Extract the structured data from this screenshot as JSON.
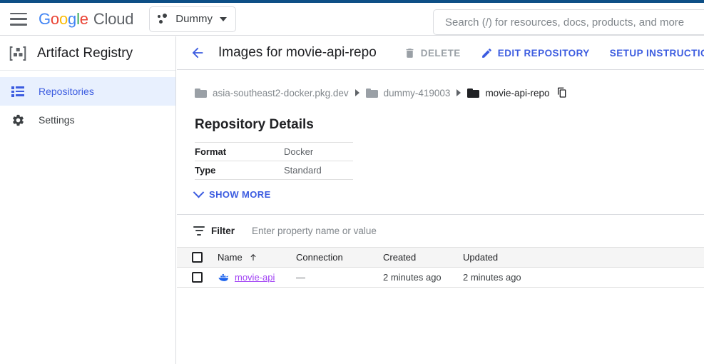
{
  "theme": {
    "accent_blue": "#3c5ce0",
    "top_stripe": "#0d4f86",
    "selected_nav_bg": "#e8f0fe",
    "visited_link_purple": "#a142f4",
    "table_header_bg": "#f5f5f5",
    "muted_text": "#5f6368"
  },
  "header": {
    "menu_icon": "hamburger-menu-icon",
    "logo": {
      "word": "Google",
      "letters": [
        "G",
        "o",
        "o",
        "g",
        "l",
        "e"
      ],
      "suffix": "Cloud"
    },
    "project_picker": {
      "icon": "project-dots-icon",
      "label": "Dummy",
      "caret": "chevron-down-icon"
    },
    "search": {
      "value": "",
      "placeholder": "Search (/) for resources, docs, products, and more",
      "icon": "search-icon"
    }
  },
  "sidebar": {
    "product_icon": "artifact-registry-icon",
    "product_title": "Artifact Registry",
    "items": [
      {
        "label": "Repositories",
        "icon": "list-icon",
        "active": true
      },
      {
        "label": "Settings",
        "icon": "gear-icon",
        "active": false
      }
    ]
  },
  "page": {
    "back_icon": "back-arrow-icon",
    "title": "Images for movie-api-repo",
    "actions": [
      {
        "label": "DELETE",
        "icon": "trash-icon",
        "state": "disabled"
      },
      {
        "label": "EDIT REPOSITORY",
        "icon": "pencil-icon",
        "state": "enabled"
      },
      {
        "label": "SETUP INSTRUCTIONS",
        "icon": "none",
        "state": "enabled"
      }
    ]
  },
  "breadcrumb": {
    "items": [
      {
        "label": "asia-southeast2-docker.pkg.dev",
        "current": false
      },
      {
        "label": "dummy-419003",
        "current": false
      },
      {
        "label": "movie-api-repo",
        "current": true
      }
    ],
    "copy_icon": "copy-icon"
  },
  "details": {
    "heading": "Repository Details",
    "rows": [
      {
        "key": "Format",
        "value": "Docker"
      },
      {
        "key": "Type",
        "value": "Standard"
      }
    ],
    "show_more_label": "SHOW MORE",
    "show_more_icon": "chevron-down-icon"
  },
  "filter": {
    "icon": "filter-icon",
    "label": "Filter",
    "value": "",
    "placeholder": "Enter property name or value"
  },
  "table": {
    "select_all_checkbox": "unchecked",
    "columns": [
      {
        "label": "Name",
        "sorted": "asc",
        "sort_icon": "arrow-up-icon"
      },
      {
        "label": "Connection",
        "sorted": "none"
      },
      {
        "label": "Created",
        "sorted": "none"
      },
      {
        "label": "Updated",
        "sorted": "none"
      }
    ],
    "rows": [
      {
        "checkbox": "unchecked",
        "icon": "docker-icon",
        "name": "movie-api",
        "connection": "—",
        "created": "2 minutes ago",
        "updated": "2 minutes ago"
      }
    ]
  }
}
